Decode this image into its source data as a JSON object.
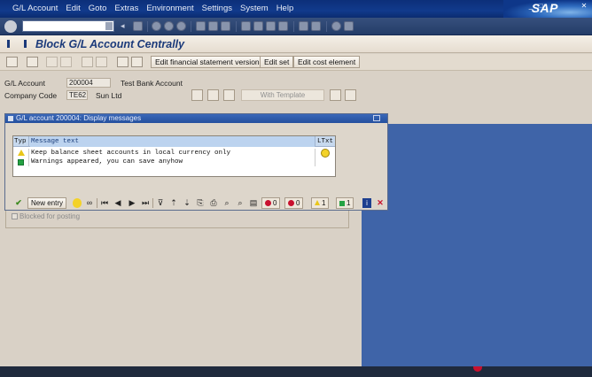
{
  "menu": [
    "G/L Account",
    "Edit",
    "Goto",
    "Extras",
    "Environment",
    "Settings",
    "System",
    "Help"
  ],
  "brand": "SAP",
  "title": "Block G/L Account Centrally",
  "app_toolbar": {
    "edit_fs_version": "Edit financial statement version",
    "edit_set": "Edit set",
    "edit_cost_element": "Edit cost element"
  },
  "header": {
    "gl_account_label": "G/L Account",
    "gl_account_value": "200004",
    "gl_account_text": "Test Bank Account",
    "company_code_label": "Company Code",
    "company_code_value": "TE62",
    "company_name": "Sun Ltd",
    "with_template": "With Template"
  },
  "blocked_for_posting": "Blocked for posting",
  "dialog": {
    "title": "G/L account 200004: Display messages",
    "columns": {
      "type": "Typ",
      "message": "Message text",
      "ltext": "LTxt"
    },
    "messages": [
      {
        "type": "warning",
        "text": "Keep balance sheet accounts in local currency only",
        "has_ltext": true
      },
      {
        "type": "success",
        "text": "Warnings appeared, you can save anyhow",
        "has_ltext": false
      }
    ],
    "toolbar": {
      "new_entry": "New entry",
      "count_stop": "0",
      "count_error": "0",
      "count_warning": "1",
      "count_success": "1"
    }
  },
  "colors": {
    "menubar": "#113a8c",
    "dialog_title": "#2a58a8",
    "warning": "#e9c61a",
    "success": "#25a243",
    "error": "#c8102e"
  }
}
